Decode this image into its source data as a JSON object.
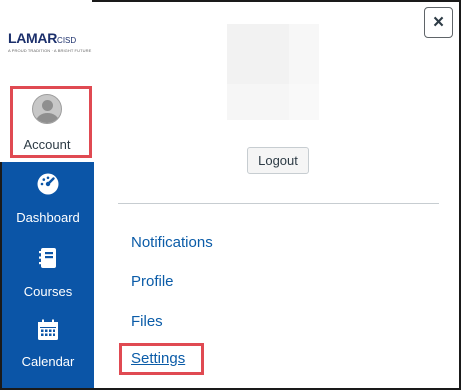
{
  "logo": {
    "name": "LAMAR",
    "suffix": "CISD",
    "tagline": "A PROUD TRADITION · A BRIGHT FUTURE"
  },
  "nav": {
    "account": "Account",
    "items": [
      {
        "label": "Dashboard",
        "icon": "dashboard-gauge-icon"
      },
      {
        "label": "Courses",
        "icon": "courses-book-icon"
      },
      {
        "label": "Calendar",
        "icon": "calendar-icon"
      }
    ]
  },
  "tray": {
    "close_label": "×",
    "logout_label": "Logout",
    "links": [
      {
        "label": "Notifications"
      },
      {
        "label": "Profile"
      },
      {
        "label": "Files"
      },
      {
        "label": "Settings"
      }
    ]
  },
  "colors": {
    "nav_blue": "#0b55a7",
    "link_blue": "#0b5ca8",
    "highlight_red": "#e04a52",
    "logo_navy": "#1b2f6b"
  }
}
